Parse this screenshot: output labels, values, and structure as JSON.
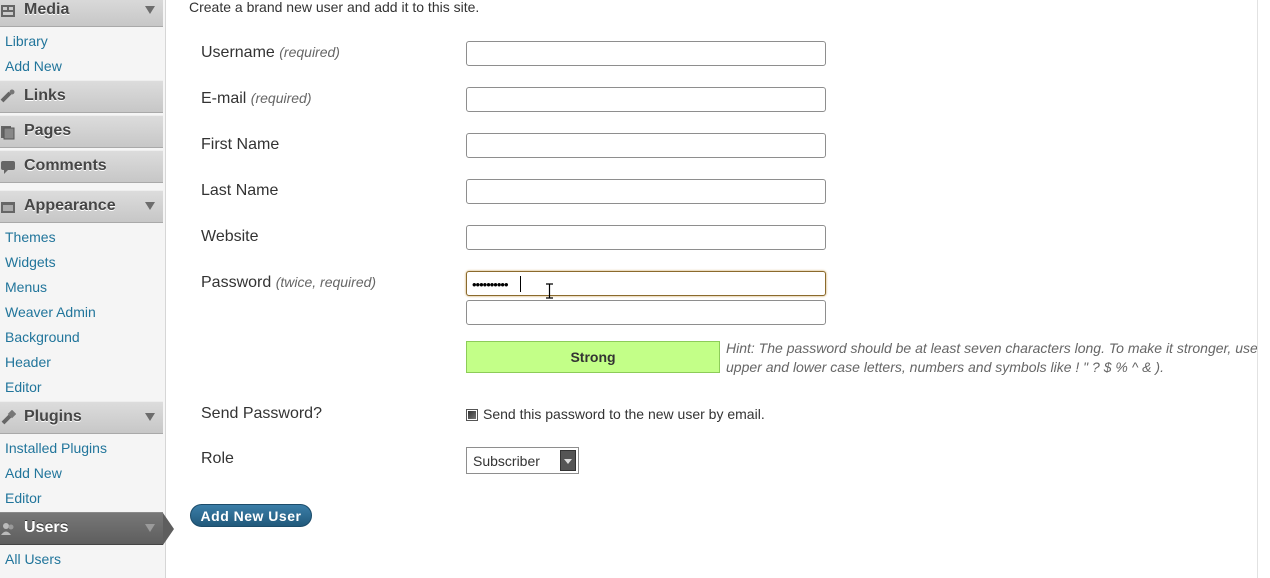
{
  "sidebar": {
    "media": {
      "label": "Media",
      "icon": "media-icon",
      "items": [
        "Library",
        "Add New"
      ]
    },
    "links": {
      "label": "Links",
      "icon": "links-icon"
    },
    "pages": {
      "label": "Pages",
      "icon": "pages-icon"
    },
    "comments": {
      "label": "Comments",
      "icon": "comments-icon"
    },
    "appearance": {
      "label": "Appearance",
      "icon": "appearance-icon",
      "items": [
        "Themes",
        "Widgets",
        "Menus",
        "Weaver Admin",
        "Background",
        "Header",
        "Editor"
      ]
    },
    "plugins": {
      "label": "Plugins",
      "icon": "plugins-icon",
      "items": [
        "Installed Plugins",
        "Add New",
        "Editor"
      ]
    },
    "users": {
      "label": "Users",
      "icon": "users-icon",
      "items": [
        "All Users"
      ]
    }
  },
  "form": {
    "intro": "Create a brand new user and add it to this site.",
    "username": {
      "label": "Username",
      "note": "(required)",
      "value": ""
    },
    "email": {
      "label": "E-mail",
      "note": "(required)",
      "value": ""
    },
    "first_name": {
      "label": "First Name",
      "value": ""
    },
    "last_name": {
      "label": "Last Name",
      "value": ""
    },
    "website": {
      "label": "Website",
      "value": ""
    },
    "password": {
      "label": "Password",
      "note": "(twice, required)",
      "value_masked": "••••••••••",
      "confirm_value": ""
    },
    "strength": "Strong",
    "hint_line1": "Hint: The password should be at least seven characters long. To make it stronger, use",
    "hint_line2": "upper and lower case letters, numbers and symbols like ! \" ? $ % ^ & ).",
    "send_password": {
      "label": "Send Password?",
      "checkbox_text": "Send this password to the new user by email.",
      "checked": true
    },
    "role": {
      "label": "Role",
      "selected": "Subscriber"
    },
    "submit": "Add New User"
  },
  "colors": {
    "link": "#21759b",
    "strength_bg": "#c3ff88",
    "button": "#21597b"
  }
}
